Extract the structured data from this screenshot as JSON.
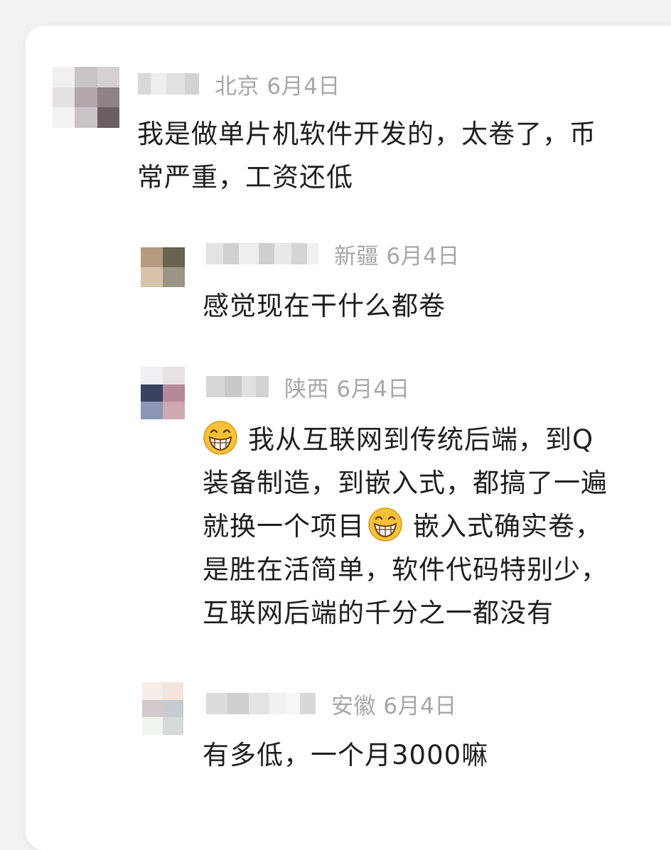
{
  "comments": [
    {
      "location": "北京",
      "date": "6月4日",
      "lines": [
        "我是做单片机软件开发的，太卷了，币",
        "常严重，工资还低"
      ]
    },
    {
      "location": "新疆",
      "date": "6月4日",
      "lines": [
        "感觉现在干什么都卷"
      ]
    },
    {
      "location": "陕西",
      "date": "6月4日",
      "emoji": "grinning-face-emoji",
      "line1": "我从互联网到传统后端，到Q",
      "line2": "装备制造，到嵌入式，都搞了一遍",
      "line3_a": "就换一个项目",
      "line3_b": "嵌入式确实卷，",
      "line4": "是胜在活简单，软件代码特别少，",
      "line5": "互联网后端的千分之一都没有"
    },
    {
      "location": "安徽",
      "date": "6月4日",
      "lines": [
        "有多低，一个月3000嘛"
      ]
    }
  ],
  "colors": {
    "background": "#f2f2f2",
    "card": "#ffffff",
    "text": "#1e1e1e",
    "meta": "#a7a7a7"
  }
}
